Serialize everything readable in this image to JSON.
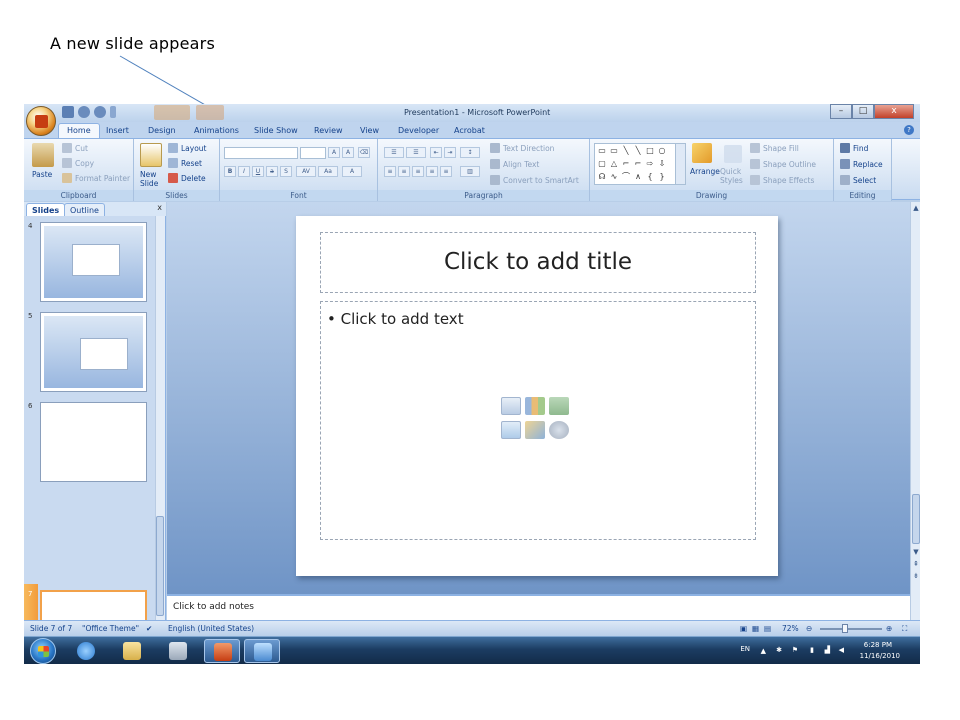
{
  "caption": "A new slide appears",
  "window": {
    "title": "Presentation1 - Microsoft PowerPoint",
    "minimize": "–",
    "maximize": "□",
    "close": "x"
  },
  "tabs": [
    "Home",
    "Insert",
    "Design",
    "Animations",
    "Slide Show",
    "Review",
    "View",
    "Developer",
    "Acrobat"
  ],
  "ribbon": {
    "clipboard": {
      "label": "Clipboard",
      "paste": "Paste",
      "cut": "Cut",
      "copy": "Copy",
      "format_painter": "Format Painter"
    },
    "slides": {
      "label": "Slides",
      "new_slide": "New Slide",
      "layout": "Layout",
      "reset": "Reset",
      "delete": "Delete"
    },
    "font": {
      "label": "Font"
    },
    "paragraph": {
      "label": "Paragraph",
      "text_direction": "Text Direction",
      "align_text": "Align Text",
      "convert_smartart": "Convert to SmartArt"
    },
    "drawing": {
      "label": "Drawing",
      "arrange": "Arrange",
      "quick_styles": "Quick Styles",
      "shape_fill": "Shape Fill",
      "shape_outline": "Shape Outline",
      "shape_effects": "Shape Effects"
    },
    "editing": {
      "label": "Editing",
      "find": "Find",
      "replace": "Replace",
      "select": "Select"
    }
  },
  "pane": {
    "tab_slides": "Slides",
    "tab_outline": "Outline",
    "close": "x",
    "thumbnails": [
      {
        "num": "4"
      },
      {
        "num": "5"
      },
      {
        "num": "6"
      },
      {
        "num": "7"
      }
    ]
  },
  "slide": {
    "title_placeholder": "Click to add title",
    "body_placeholder": "Click to add text"
  },
  "notes_placeholder": "Click to add notes",
  "status": {
    "slide_count": "Slide 7 of 7",
    "theme": "\"Office Theme\"",
    "language": "English (United States)",
    "zoom": "72%"
  },
  "taskbar": {
    "lang": "EN",
    "time": "6:28 PM",
    "date": "11/16/2010"
  }
}
